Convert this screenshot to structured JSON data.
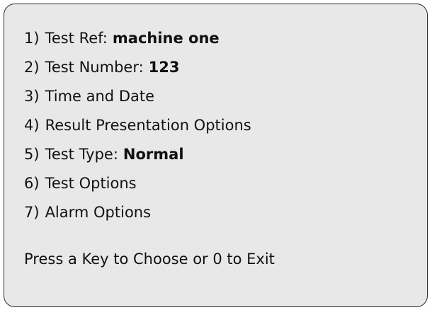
{
  "menu": {
    "items": [
      {
        "number": "1)",
        "label": "Test Ref:",
        "value": "machine one"
      },
      {
        "number": "2)",
        "label": "Test Number:",
        "value": "123"
      },
      {
        "number": "3)",
        "label": "Time and Date"
      },
      {
        "number": "4)",
        "label": "Result Presentation Options"
      },
      {
        "number": "5)",
        "label": "Test Type:",
        "value": "Normal"
      },
      {
        "number": "6)",
        "label": "Test Options"
      },
      {
        "number": "7)",
        "label": "Alarm Options"
      }
    ]
  },
  "prompt": "Press a Key to Choose or 0 to Exit"
}
